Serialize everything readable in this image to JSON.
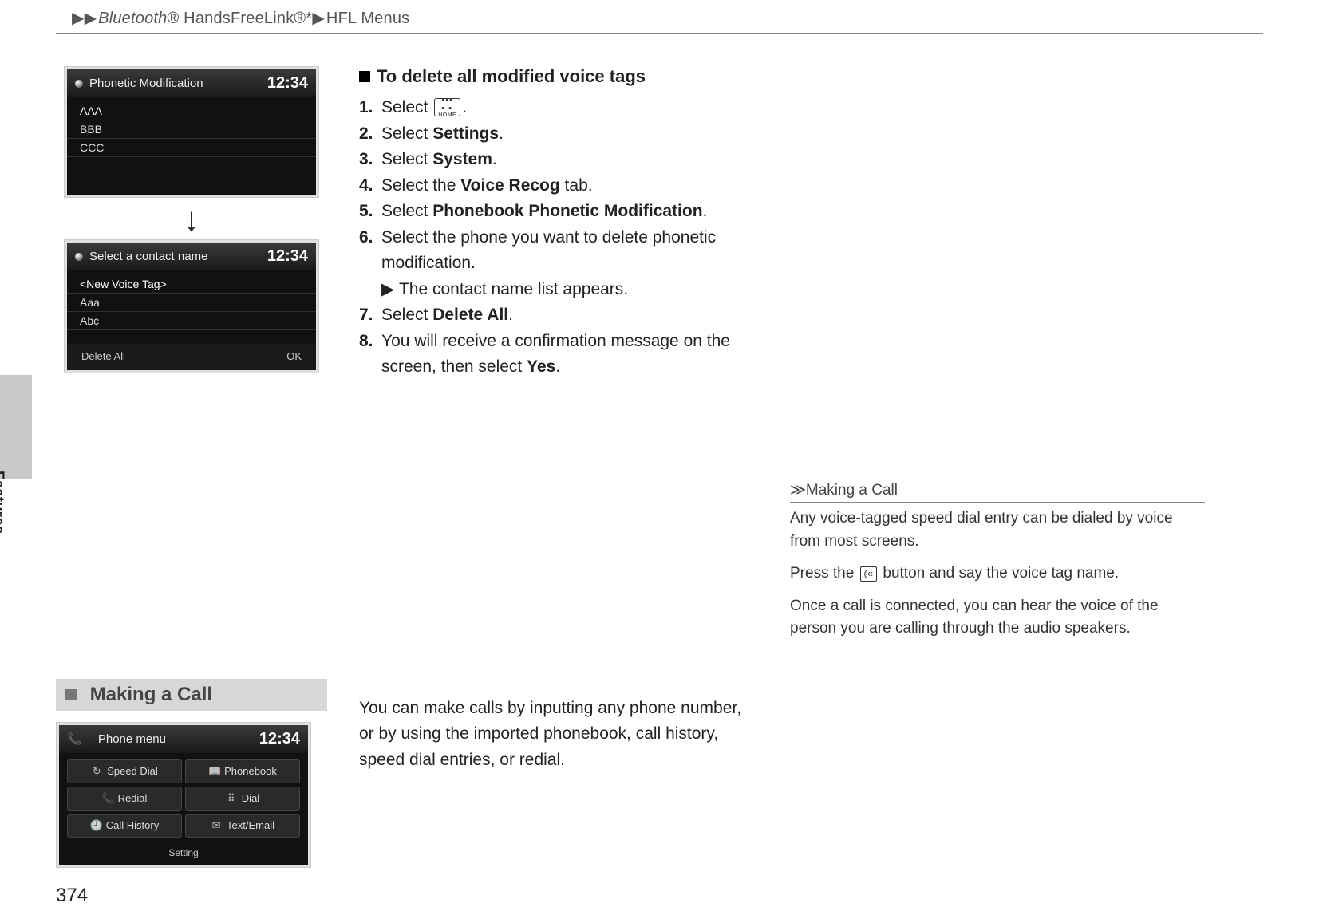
{
  "header": {
    "crumb1": "Bluetooth",
    "crumb1_suffix": "® HandsFreeLink®*",
    "crumb2": "HFL Menus"
  },
  "side_tab": "Features",
  "page_number": "374",
  "screen1": {
    "title": "Phonetic Modification",
    "clock": "12:34",
    "rows": [
      "AAA",
      "BBB",
      "CCC"
    ]
  },
  "screen2": {
    "title": "Select a contact name",
    "clock": "12:34",
    "rows": [
      "<New Voice Tag>",
      "Aaa",
      "Abc"
    ],
    "foot_left": "Delete All",
    "foot_right": "OK"
  },
  "screen3": {
    "title": "Phone menu",
    "clock": "12:34",
    "cells": [
      "Speed Dial",
      "Phonebook",
      "Redial",
      "Dial",
      "Call History",
      "Text/Email"
    ],
    "setting": "Setting"
  },
  "steps_heading": "To delete all modified voice tags",
  "steps": {
    "s1a": "Select ",
    "s1b": ".",
    "s2a": "Select ",
    "s2b": "Settings",
    "s2c": ".",
    "s3a": "Select ",
    "s3b": "System",
    "s3c": ".",
    "s4a": "Select the ",
    "s4b": "Voice Recog",
    "s4c": " tab.",
    "s5a": "Select ",
    "s5b": "Phonebook Phonetic Modification",
    "s5c": ".",
    "s6a": "Select the phone you want to delete phonetic modification.",
    "s6note": "The contact name list appears.",
    "s7a": "Select ",
    "s7b": "Delete All",
    "s7c": ".",
    "s8a": "You will receive a confirmation message on the screen, then select ",
    "s8b": "Yes",
    "s8c": "."
  },
  "section2": {
    "title": "Making a Call",
    "para": "You can make calls by inputting any phone number, or by using the imported phonebook, call history, speed dial entries, or redial."
  },
  "sidenote": {
    "title": "Making a Call",
    "p1": "Any voice-tagged speed dial entry can be dialed by voice from most screens.",
    "p2a": "Press the ",
    "p2b": " button and say the voice tag name.",
    "p3": "Once a call is connected, you can hear the voice of the person you are calling through the audio speakers."
  },
  "home_button_label": "HOME"
}
